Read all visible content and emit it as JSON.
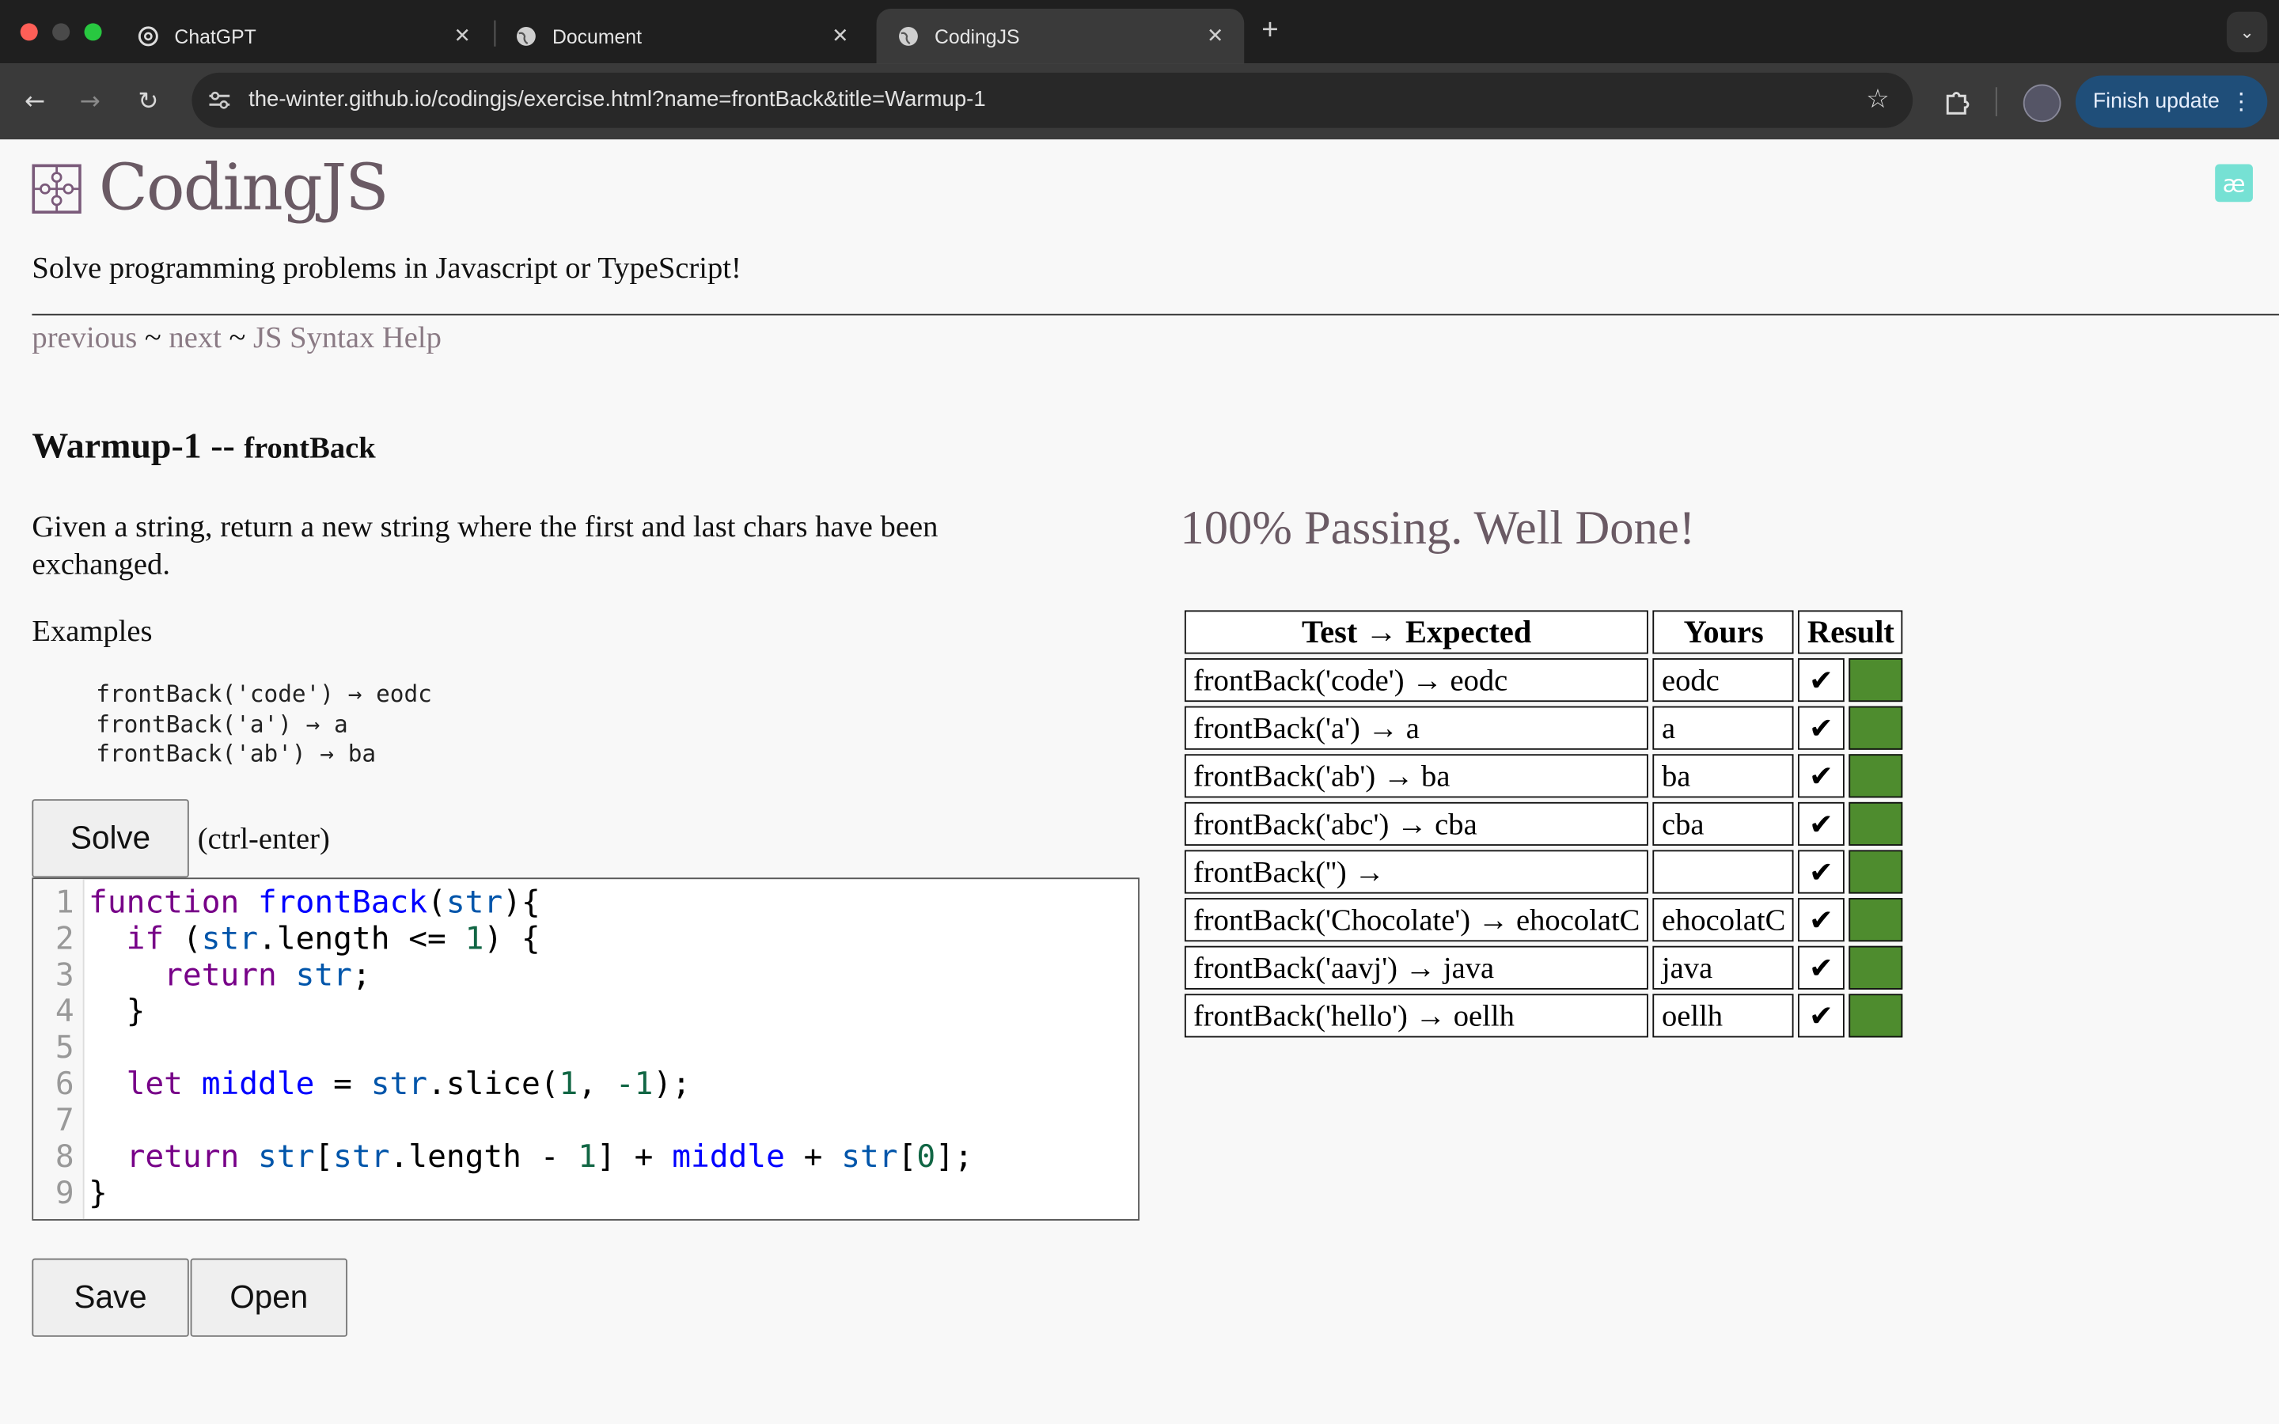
{
  "browser": {
    "tabs": [
      {
        "title": "ChatGPT",
        "icon": "openai-icon"
      },
      {
        "title": "Document",
        "icon": "globe-icon"
      },
      {
        "title": "CodingJS",
        "icon": "globe-icon",
        "active": true
      }
    ],
    "url": "the-winter.github.io/codingjs/exercise.html?name=frontBack&title=Warmup-1",
    "update_label": "Finish update"
  },
  "site": {
    "brand": "CodingJS",
    "tagline": "Solve programming problems in Javascript or TypeScript!",
    "nav": {
      "previous": "previous",
      "sep1": "~",
      "next": "next",
      "sep2": "~",
      "help": "JS Syntax Help"
    },
    "ae_badge": "æ"
  },
  "exercise": {
    "section": "Warmup-1 --",
    "name": "frontBack",
    "description": "Given a string, return a new string where the first and last chars have been exchanged.",
    "examples_title": "Examples",
    "examples": [
      "frontBack('code') → eodc",
      "frontBack('a') → a",
      "frontBack('ab') → ba"
    ],
    "solve_label": "Solve",
    "solve_hint": "(ctrl-enter)",
    "save_label": "Save",
    "open_label": "Open",
    "line_numbers": [
      "1",
      "2",
      "3",
      "4",
      "5",
      "6",
      "7",
      "8",
      "9"
    ]
  },
  "results": {
    "title": "100% Passing. Well Done!",
    "headers": [
      "Test → Expected",
      "Yours",
      "Result"
    ],
    "rows": [
      {
        "test": "frontBack('code') → eodc",
        "yours": "eodc",
        "check": "✔",
        "pass": true
      },
      {
        "test": "frontBack('a') → a",
        "yours": "a",
        "check": "✔",
        "pass": true
      },
      {
        "test": "frontBack('ab') → ba",
        "yours": "ba",
        "check": "✔",
        "pass": true
      },
      {
        "test": "frontBack('abc') → cba",
        "yours": "cba",
        "check": "✔",
        "pass": true
      },
      {
        "test": "frontBack('') →",
        "yours": "",
        "check": "✔",
        "pass": true
      },
      {
        "test": "frontBack('Chocolate') → ehocolatC",
        "yours": "ehocolatC",
        "check": "✔",
        "pass": true
      },
      {
        "test": "frontBack('aavj') → java",
        "yours": "java",
        "check": "✔",
        "pass": true
      },
      {
        "test": "frontBack('hello') → oellh",
        "yours": "oellh",
        "check": "✔",
        "pass": true
      }
    ],
    "pass_color": "#4e8c2e"
  },
  "code_tokens": {
    "l1_kw": "function",
    "l1_fn": "frontBack",
    "l1_p1": "(",
    "l1_var": "str",
    "l1_p2": "){",
    "l2_kw": "if",
    "l2_a": " (",
    "l2_var": "str",
    "l2_b": ".length <= ",
    "l2_num": "1",
    "l2_c": ") {",
    "l3_kw": "return",
    "l3_sp": " ",
    "l3_var": "str",
    "l3_end": ";",
    "l4": "}",
    "l6_kw": "let",
    "l6_sp": " ",
    "l6_def": "middle",
    "l6_eq": " = ",
    "l6_var": "str",
    "l6_a": ".slice(",
    "l6_n1": "1",
    "l6_b": ", ",
    "l6_n2": "-1",
    "l6_c": ");",
    "l8_kw": "return",
    "l8_sp": " ",
    "l8_v1": "str",
    "l8_a": "[",
    "l8_v2": "str",
    "l8_b": ".length - ",
    "l8_n1": "1",
    "l8_c": "] + ",
    "l8_v3": "middle",
    "l8_d": " + ",
    "l8_v4": "str",
    "l8_e": "[",
    "l8_n2": "0",
    "l8_f": "];",
    "l9": "}"
  }
}
